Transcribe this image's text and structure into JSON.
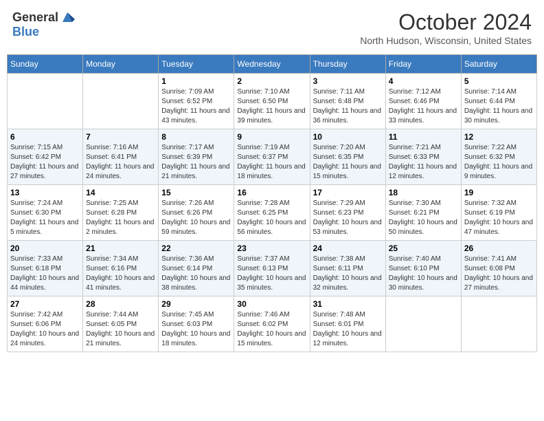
{
  "header": {
    "logo_line1": "General",
    "logo_line2": "Blue",
    "month_title": "October 2024",
    "location": "North Hudson, Wisconsin, United States"
  },
  "days_of_week": [
    "Sunday",
    "Monday",
    "Tuesday",
    "Wednesday",
    "Thursday",
    "Friday",
    "Saturday"
  ],
  "weeks": [
    [
      {
        "day": "",
        "sunrise": "",
        "sunset": "",
        "daylight": ""
      },
      {
        "day": "",
        "sunrise": "",
        "sunset": "",
        "daylight": ""
      },
      {
        "day": "1",
        "sunrise": "Sunrise: 7:09 AM",
        "sunset": "Sunset: 6:52 PM",
        "daylight": "Daylight: 11 hours and 43 minutes."
      },
      {
        "day": "2",
        "sunrise": "Sunrise: 7:10 AM",
        "sunset": "Sunset: 6:50 PM",
        "daylight": "Daylight: 11 hours and 39 minutes."
      },
      {
        "day": "3",
        "sunrise": "Sunrise: 7:11 AM",
        "sunset": "Sunset: 6:48 PM",
        "daylight": "Daylight: 11 hours and 36 minutes."
      },
      {
        "day": "4",
        "sunrise": "Sunrise: 7:12 AM",
        "sunset": "Sunset: 6:46 PM",
        "daylight": "Daylight: 11 hours and 33 minutes."
      },
      {
        "day": "5",
        "sunrise": "Sunrise: 7:14 AM",
        "sunset": "Sunset: 6:44 PM",
        "daylight": "Daylight: 11 hours and 30 minutes."
      }
    ],
    [
      {
        "day": "6",
        "sunrise": "Sunrise: 7:15 AM",
        "sunset": "Sunset: 6:42 PM",
        "daylight": "Daylight: 11 hours and 27 minutes."
      },
      {
        "day": "7",
        "sunrise": "Sunrise: 7:16 AM",
        "sunset": "Sunset: 6:41 PM",
        "daylight": "Daylight: 11 hours and 24 minutes."
      },
      {
        "day": "8",
        "sunrise": "Sunrise: 7:17 AM",
        "sunset": "Sunset: 6:39 PM",
        "daylight": "Daylight: 11 hours and 21 minutes."
      },
      {
        "day": "9",
        "sunrise": "Sunrise: 7:19 AM",
        "sunset": "Sunset: 6:37 PM",
        "daylight": "Daylight: 11 hours and 18 minutes."
      },
      {
        "day": "10",
        "sunrise": "Sunrise: 7:20 AM",
        "sunset": "Sunset: 6:35 PM",
        "daylight": "Daylight: 11 hours and 15 minutes."
      },
      {
        "day": "11",
        "sunrise": "Sunrise: 7:21 AM",
        "sunset": "Sunset: 6:33 PM",
        "daylight": "Daylight: 11 hours and 12 minutes."
      },
      {
        "day": "12",
        "sunrise": "Sunrise: 7:22 AM",
        "sunset": "Sunset: 6:32 PM",
        "daylight": "Daylight: 11 hours and 9 minutes."
      }
    ],
    [
      {
        "day": "13",
        "sunrise": "Sunrise: 7:24 AM",
        "sunset": "Sunset: 6:30 PM",
        "daylight": "Daylight: 11 hours and 5 minutes."
      },
      {
        "day": "14",
        "sunrise": "Sunrise: 7:25 AM",
        "sunset": "Sunset: 6:28 PM",
        "daylight": "Daylight: 11 hours and 2 minutes."
      },
      {
        "day": "15",
        "sunrise": "Sunrise: 7:26 AM",
        "sunset": "Sunset: 6:26 PM",
        "daylight": "Daylight: 10 hours and 59 minutes."
      },
      {
        "day": "16",
        "sunrise": "Sunrise: 7:28 AM",
        "sunset": "Sunset: 6:25 PM",
        "daylight": "Daylight: 10 hours and 56 minutes."
      },
      {
        "day": "17",
        "sunrise": "Sunrise: 7:29 AM",
        "sunset": "Sunset: 6:23 PM",
        "daylight": "Daylight: 10 hours and 53 minutes."
      },
      {
        "day": "18",
        "sunrise": "Sunrise: 7:30 AM",
        "sunset": "Sunset: 6:21 PM",
        "daylight": "Daylight: 10 hours and 50 minutes."
      },
      {
        "day": "19",
        "sunrise": "Sunrise: 7:32 AM",
        "sunset": "Sunset: 6:19 PM",
        "daylight": "Daylight: 10 hours and 47 minutes."
      }
    ],
    [
      {
        "day": "20",
        "sunrise": "Sunrise: 7:33 AM",
        "sunset": "Sunset: 6:18 PM",
        "daylight": "Daylight: 10 hours and 44 minutes."
      },
      {
        "day": "21",
        "sunrise": "Sunrise: 7:34 AM",
        "sunset": "Sunset: 6:16 PM",
        "daylight": "Daylight: 10 hours and 41 minutes."
      },
      {
        "day": "22",
        "sunrise": "Sunrise: 7:36 AM",
        "sunset": "Sunset: 6:14 PM",
        "daylight": "Daylight: 10 hours and 38 minutes."
      },
      {
        "day": "23",
        "sunrise": "Sunrise: 7:37 AM",
        "sunset": "Sunset: 6:13 PM",
        "daylight": "Daylight: 10 hours and 35 minutes."
      },
      {
        "day": "24",
        "sunrise": "Sunrise: 7:38 AM",
        "sunset": "Sunset: 6:11 PM",
        "daylight": "Daylight: 10 hours and 32 minutes."
      },
      {
        "day": "25",
        "sunrise": "Sunrise: 7:40 AM",
        "sunset": "Sunset: 6:10 PM",
        "daylight": "Daylight: 10 hours and 30 minutes."
      },
      {
        "day": "26",
        "sunrise": "Sunrise: 7:41 AM",
        "sunset": "Sunset: 6:08 PM",
        "daylight": "Daylight: 10 hours and 27 minutes."
      }
    ],
    [
      {
        "day": "27",
        "sunrise": "Sunrise: 7:42 AM",
        "sunset": "Sunset: 6:06 PM",
        "daylight": "Daylight: 10 hours and 24 minutes."
      },
      {
        "day": "28",
        "sunrise": "Sunrise: 7:44 AM",
        "sunset": "Sunset: 6:05 PM",
        "daylight": "Daylight: 10 hours and 21 minutes."
      },
      {
        "day": "29",
        "sunrise": "Sunrise: 7:45 AM",
        "sunset": "Sunset: 6:03 PM",
        "daylight": "Daylight: 10 hours and 18 minutes."
      },
      {
        "day": "30",
        "sunrise": "Sunrise: 7:46 AM",
        "sunset": "Sunset: 6:02 PM",
        "daylight": "Daylight: 10 hours and 15 minutes."
      },
      {
        "day": "31",
        "sunrise": "Sunrise: 7:48 AM",
        "sunset": "Sunset: 6:01 PM",
        "daylight": "Daylight: 10 hours and 12 minutes."
      },
      {
        "day": "",
        "sunrise": "",
        "sunset": "",
        "daylight": ""
      },
      {
        "day": "",
        "sunrise": "",
        "sunset": "",
        "daylight": ""
      }
    ]
  ]
}
